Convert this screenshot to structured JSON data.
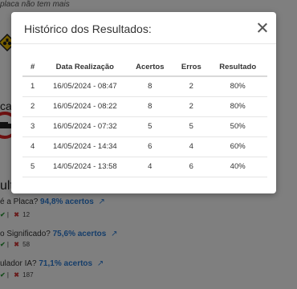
{
  "background": {
    "top_text": "placa não tem mais",
    "section_fragment": "cas",
    "results_fragment": "ultad",
    "stats": [
      {
        "question": "é a Placa?",
        "percent": "94,8% acertos",
        "ok": "",
        "errors": "12"
      },
      {
        "question": "o Significado?",
        "percent": "75,6% acertos",
        "ok": "",
        "errors": "58"
      },
      {
        "question": "ulador IA?",
        "percent": "71,1% acertos",
        "ok": "",
        "errors": "187"
      }
    ]
  },
  "modal": {
    "title": "Histórico dos Resultados:",
    "columns": [
      "#",
      "Data Realização",
      "Acertos",
      "Erros",
      "Resultado"
    ],
    "rows": [
      [
        "1",
        "16/05/2024 - 08:47",
        "8",
        "2",
        "80%"
      ],
      [
        "2",
        "16/05/2024 - 08:22",
        "8",
        "2",
        "80%"
      ],
      [
        "3",
        "16/05/2024 - 07:32",
        "5",
        "5",
        "50%"
      ],
      [
        "4",
        "14/05/2024 - 14:34",
        "6",
        "4",
        "60%"
      ],
      [
        "5",
        "14/05/2024 - 13:58",
        "4",
        "6",
        "40%"
      ]
    ]
  }
}
